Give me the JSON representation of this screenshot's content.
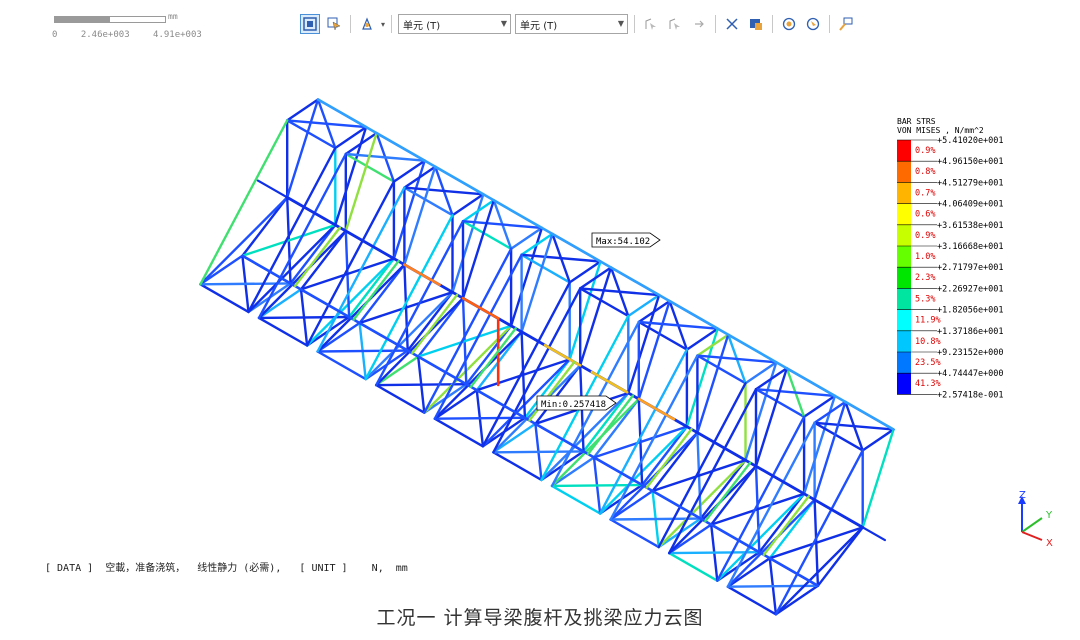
{
  "scale_bar": {
    "unit": "mm",
    "ticks": [
      "0",
      "2.46e+003",
      "4.91e+003"
    ]
  },
  "toolbar": {
    "select1": "单元 (T)",
    "select2": "单元 (T)",
    "colors": {
      "accent": "#4a90d9",
      "icon_blue": "#2f5fb0",
      "icon_orange": "#e8a33c"
    }
  },
  "legend": {
    "title_line1": "BAR STRS",
    "title_line2": "VON MISES , N/mm^2",
    "values": [
      "+5.41020e+001",
      "+4.96150e+001",
      "+4.51279e+001",
      "+4.06409e+001",
      "+3.61538e+001",
      "+3.16668e+001",
      "+2.71797e+001",
      "+2.26927e+001",
      "+1.82056e+001",
      "+1.37186e+001",
      "+9.23152e+000",
      "+4.74447e+000",
      "+2.57418e-001"
    ],
    "percents": [
      "0.9%",
      "0.8%",
      "0.7%",
      "0.6%",
      "0.9%",
      "1.0%",
      "2.3%",
      "5.3%",
      "11.9%",
      "10.8%",
      "23.5%",
      "41.3%"
    ],
    "colors": [
      "#ff0000",
      "#ff6a00",
      "#ffb400",
      "#ffff00",
      "#c8ff00",
      "#66ff00",
      "#00e600",
      "#00e6a0",
      "#00ffff",
      "#00c8ff",
      "#0078ff",
      "#0000ff"
    ]
  },
  "markers": {
    "max": "Max:54.102",
    "min": "Min:0.257418"
  },
  "status": {
    "data_tag": "[ DATA ]",
    "data_text": "空載，准备浇筑，  线性静力 (必需),",
    "unit_tag": "[ UNIT ]",
    "unit_text": "N,  mm"
  },
  "axis_triad": {
    "z": "Z",
    "y": "Y",
    "x": "X"
  },
  "caption": "工况一   计算导梁腹杆及挑梁应力云图"
}
